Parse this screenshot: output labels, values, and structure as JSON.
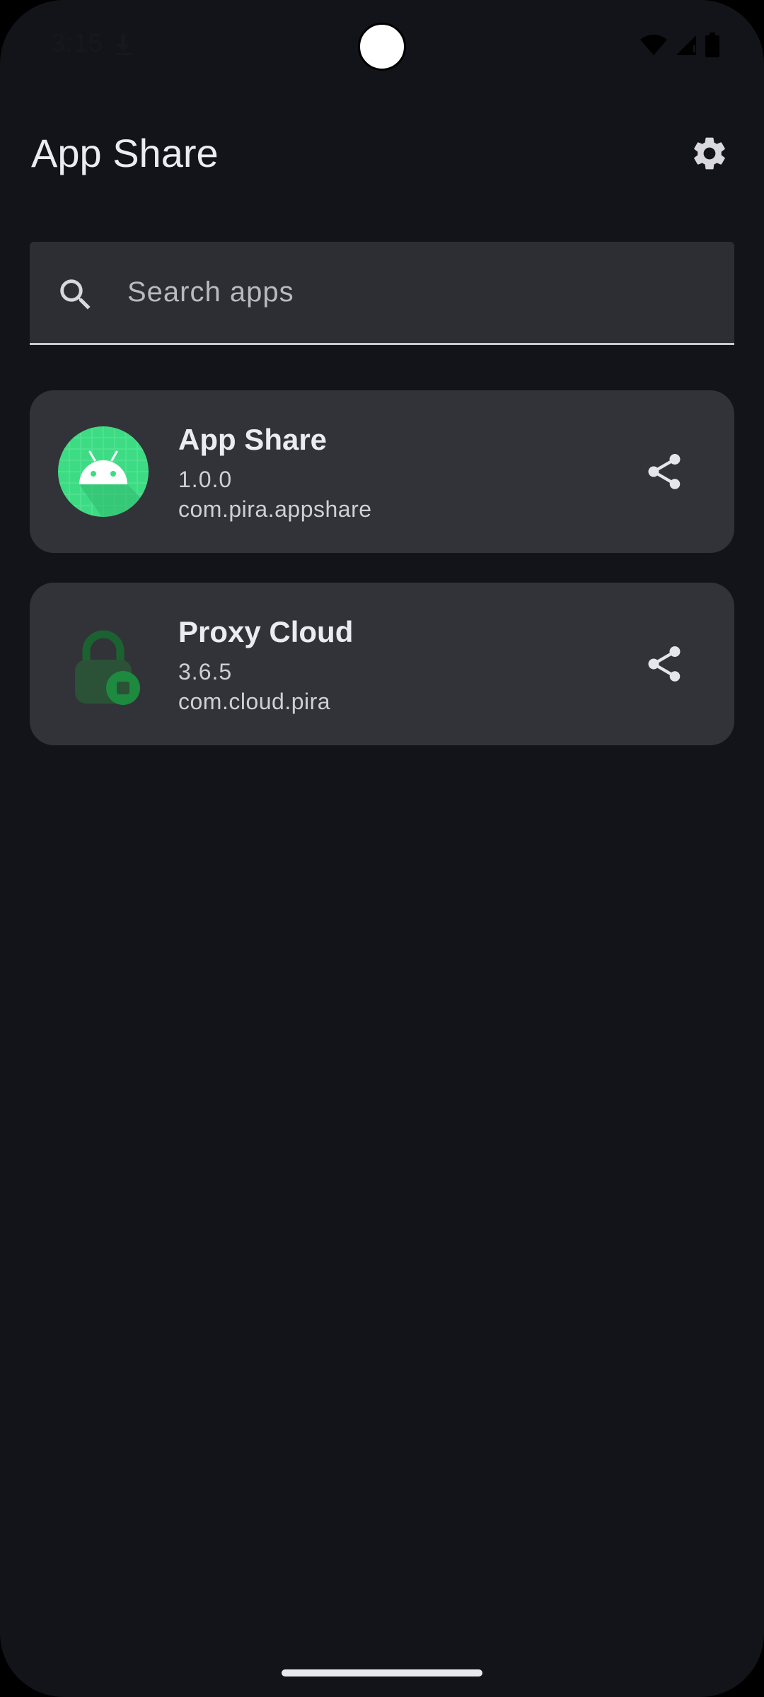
{
  "status_bar": {
    "time": "3:15",
    "icons": [
      "download-icon",
      "wifi-icon",
      "signal-icon",
      "battery-icon"
    ]
  },
  "header": {
    "title": "App Share",
    "settings_icon": "gear-icon"
  },
  "search": {
    "placeholder": "Search apps",
    "value": "",
    "icon": "search-icon"
  },
  "apps": [
    {
      "name": "App Share",
      "version": "1.0.0",
      "package": "com.pira.appshare",
      "icon": "android-app-icon",
      "action_icon": "share-icon"
    },
    {
      "name": "Proxy Cloud",
      "version": "3.6.5",
      "package": "com.cloud.pira",
      "icon": "lock-app-icon",
      "action_icon": "share-icon"
    }
  ],
  "colors": {
    "background": "#131419",
    "card": "#323338",
    "search_field": "#2d2e33",
    "text_primary": "#ececf0",
    "text_secondary": "#cfd0d6",
    "android_green": "#3ddc84",
    "lock_green": "#1d6b35"
  }
}
